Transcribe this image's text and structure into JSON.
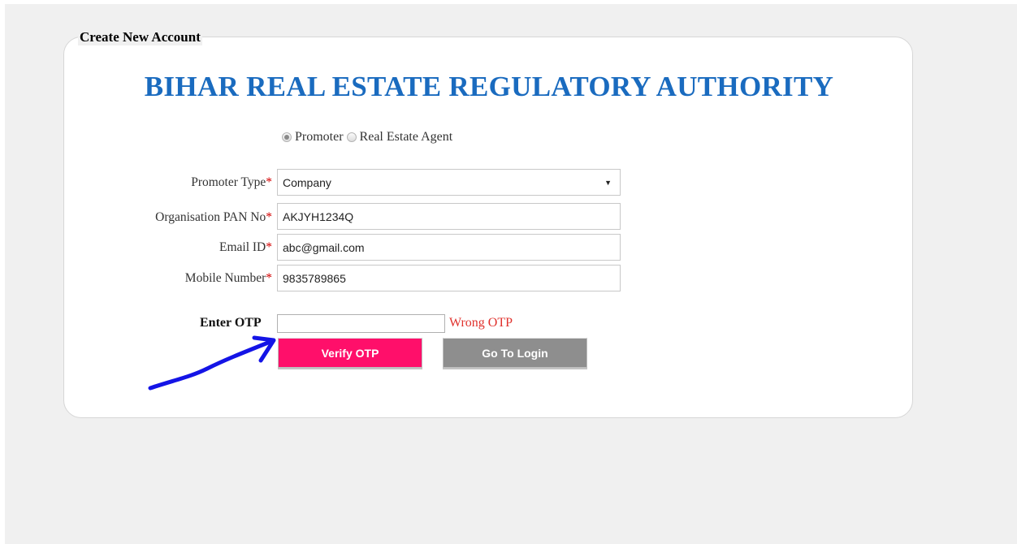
{
  "form": {
    "legend": "Create New Account",
    "title": "BIHAR REAL ESTATE REGULATORY AUTHORITY",
    "account_types": [
      {
        "label": "Promoter",
        "checked": true
      },
      {
        "label": "Real Estate Agent",
        "checked": false
      }
    ],
    "required_marker": "*",
    "fields": {
      "promoter_type": {
        "label": "Promoter Type",
        "value": "Company"
      },
      "pan": {
        "label": "Organisation  PAN No",
        "value": "AKJYH1234Q"
      },
      "email": {
        "label": "Email ID",
        "value": "abc@gmail.com"
      },
      "mobile": {
        "label": "Mobile Number",
        "value": "9835789865"
      }
    },
    "otp": {
      "label": "Enter OTP",
      "value": "",
      "error": "Wrong OTP"
    },
    "buttons": {
      "verify": "Verify OTP",
      "login": "Go To Login"
    }
  },
  "annotation": {
    "arrow_color": "#1414e6"
  },
  "colors": {
    "title": "#1a6bbf",
    "required": "#d40000",
    "error": "#e0312c",
    "verify_button": "#ff0f6a",
    "login_button": "#8e8e8e",
    "page_bg": "#f0f0f0"
  }
}
